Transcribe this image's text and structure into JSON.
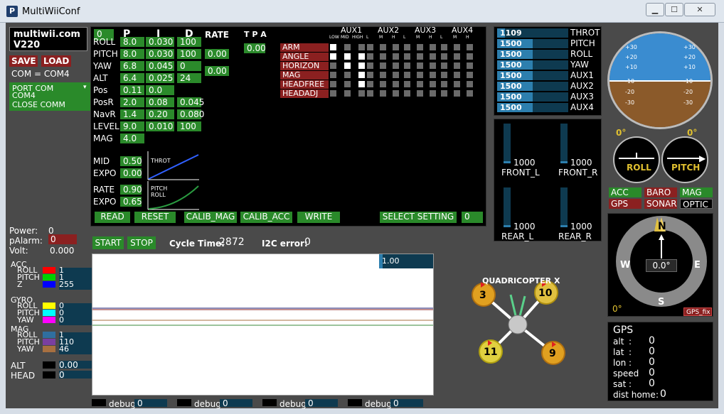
{
  "window": {
    "title": "MultiWiiConf"
  },
  "brand": {
    "name": "multiwii.com",
    "version": "V220"
  },
  "com": {
    "save": "SAVE",
    "load": "LOAD",
    "com_label": "COM = COM4",
    "port_com": "PORT COM",
    "port_value": "COM4",
    "close_comm": "CLOSE COMM"
  },
  "pid": {
    "setting_index": "0",
    "headers": {
      "p": "P",
      "i": "I",
      "d": "D",
      "rate": "RATE",
      "tpa": "T P A"
    },
    "tpa_value": "0.00",
    "rows": [
      {
        "name": "ROLL",
        "p": "8.0",
        "i": "0.030",
        "d": "100"
      },
      {
        "name": "PITCH",
        "p": "8.0",
        "i": "0.030",
        "d": "100"
      },
      {
        "name": "YAW",
        "p": "6.8",
        "i": "0.045",
        "d": "0"
      },
      {
        "name": "ALT",
        "p": "6.4",
        "i": "0.025",
        "d": "24"
      },
      {
        "name": "Pos",
        "p": "0.11",
        "i": "0.0",
        "d": ""
      },
      {
        "name": "PosR",
        "p": "2.0",
        "i": "0.08",
        "d": "0.045"
      },
      {
        "name": "NavR",
        "p": "1.4",
        "i": "0.20",
        "d": "0.080"
      },
      {
        "name": "LEVEL",
        "p": "9.0",
        "i": "0.010",
        "d": "100"
      },
      {
        "name": "MAG",
        "p": "4.0",
        "i": "",
        "d": ""
      }
    ],
    "rate_rollpitch": "0.00",
    "rate_yaw": "0.00",
    "throttle": {
      "mid_label": "MID",
      "mid": "0.50",
      "expo_label": "EXPO",
      "expo": "0.00",
      "curve_label": "THROT"
    },
    "rc": {
      "rate_label": "RATE",
      "rate": "0.90",
      "expo_label": "EXPO",
      "expo": "0.65",
      "curve_label_1": "PITCH",
      "curve_label_2": "ROLL"
    }
  },
  "buttons": {
    "read": "READ",
    "reset": "RESET",
    "calib_mag": "CALIB_MAG",
    "calib_acc": "CALIB_ACC",
    "write": "WRITE",
    "select_setting": "SELECT SETTING",
    "select_value": "0"
  },
  "aux": {
    "headers": [
      "AUX1",
      "AUX2",
      "AUX3",
      "AUX4"
    ],
    "sub_first": [
      "LOW",
      "MID",
      "HIGH"
    ],
    "sub": [
      "L",
      "M",
      "H"
    ],
    "boxes": [
      {
        "name": "ARM",
        "checks": [
          1,
          0,
          0,
          0,
          0,
          0,
          0,
          0,
          0,
          0,
          0,
          0
        ]
      },
      {
        "name": "ANGLE",
        "checks": [
          1,
          1,
          1,
          0,
          0,
          0,
          0,
          0,
          0,
          0,
          0,
          0
        ]
      },
      {
        "name": "HORIZON",
        "checks": [
          0,
          1,
          1,
          0,
          0,
          0,
          0,
          0,
          0,
          0,
          0,
          0
        ]
      },
      {
        "name": "MAG",
        "checks": [
          0,
          0,
          1,
          0,
          0,
          0,
          0,
          0,
          0,
          0,
          0,
          0
        ]
      },
      {
        "name": "HEADFREE",
        "checks": [
          0,
          0,
          1,
          0,
          0,
          0,
          0,
          0,
          0,
          0,
          0,
          0
        ]
      },
      {
        "name": "HEADADJ",
        "checks": [
          0,
          0,
          0,
          0,
          0,
          0,
          0,
          0,
          0,
          0,
          0,
          0
        ]
      }
    ]
  },
  "rc_channels": [
    {
      "name": "THROT",
      "value": "1109",
      "fraction": 0.11
    },
    {
      "name": "PITCH",
      "value": "1500",
      "fraction": 0.5
    },
    {
      "name": "ROLL",
      "value": "1500",
      "fraction": 0.5
    },
    {
      "name": "YAW",
      "value": "1500",
      "fraction": 0.5
    },
    {
      "name": "AUX1",
      "value": "1500",
      "fraction": 0.5
    },
    {
      "name": "AUX2",
      "value": "1500",
      "fraction": 0.5
    },
    {
      "name": "AUX3",
      "value": "1500",
      "fraction": 0.5
    },
    {
      "name": "AUX4",
      "value": "1500",
      "fraction": 0.5
    }
  ],
  "motors": [
    {
      "name": "FRONT_L",
      "value": "1000",
      "fraction": 0.05
    },
    {
      "name": "FRONT_R",
      "value": "1000",
      "fraction": 0.05
    },
    {
      "name": "REAR_L",
      "value": "1000",
      "fraction": 0.05
    },
    {
      "name": "REAR_R",
      "value": "1000",
      "fraction": 0.05
    }
  ],
  "status": {
    "power_label": "Power:",
    "power": "0",
    "palarm_label": "pAlarm:",
    "palarm": "0",
    "volt_label": "Volt:",
    "volt": "0.000",
    "start": "START",
    "stop": "STOP",
    "cycle_label": "Cycle Time:",
    "cycle": "2872",
    "i2c_label": "I2C error:",
    "i2c": "0"
  },
  "sensors": {
    "acc": {
      "label": "ACC",
      "roll": "1",
      "pitch": "1",
      "z": "255"
    },
    "gyro": {
      "label": "GYRO",
      "roll": "0",
      "pitch": "0",
      "yaw": "0"
    },
    "mag": {
      "label": "MAG",
      "roll": "1",
      "pitch": "110",
      "yaw": "46"
    },
    "alt": {
      "label": "ALT",
      "value": "0.00"
    },
    "head": {
      "label": "HEAD",
      "value": "0"
    },
    "axis_labels": {
      "roll": "ROLL",
      "pitch": "PITCH",
      "yaw": "YAW",
      "z": "Z"
    },
    "colors": {
      "roll": "#ff0000",
      "pitch": "#00d000",
      "yaw": "#ff00ff",
      "z": "#0000ff",
      "gyro_roll": "#ffff00",
      "gyro_pitch": "#00ffff",
      "mag_roll": "#2f6fa0",
      "mag_pitch": "#7a3fa0",
      "mag_yaw": "#a87040"
    }
  },
  "graph": {
    "scale": "1.00"
  },
  "debug": [
    {
      "label": "debug",
      "value": "0"
    },
    {
      "label": "debug",
      "value": "0"
    },
    {
      "label": "debug",
      "value": "0"
    },
    {
      "label": "debug",
      "value": "0"
    }
  ],
  "quad": {
    "title": "QUADRICOPTER X",
    "motors": [
      "3",
      "10",
      "11",
      "9"
    ]
  },
  "horizon": {
    "ticks_left": [
      "+30",
      "+20",
      "+10",
      "-10",
      "-20",
      "-30"
    ],
    "ticks_right": [
      "+30",
      "+20",
      "+10",
      "-10",
      "-20",
      "-30"
    ],
    "roll_angle": "0°",
    "pitch_angle": "0°",
    "roll_label": "ROLL",
    "pitch_label": "PITCH"
  },
  "sensor_flags": [
    {
      "name": "ACC",
      "color": "#2a8a2a"
    },
    {
      "name": "BARO",
      "color": "#8b2020"
    },
    {
      "name": "MAG",
      "color": "#2a8a2a"
    },
    {
      "name": "GPS",
      "color": "#8b2020"
    },
    {
      "name": "SONAR",
      "color": "#8b2020"
    },
    {
      "name": "OPTIC",
      "color": "#000000"
    }
  ],
  "compass": {
    "heading": "0.0°",
    "n": "N",
    "s": "S",
    "e": "E",
    "w": "W",
    "zero": "0°",
    "gps_fix": "GPS_fix"
  },
  "gps": {
    "title": "GPS",
    "rows": [
      {
        "label": "alt",
        "value": "0"
      },
      {
        "label": "lat",
        "value": "0"
      },
      {
        "label": "lon",
        "value": "0"
      },
      {
        "label": "speed",
        "value": "0"
      },
      {
        "label": "sat",
        "value": "0"
      },
      {
        "label": "dist home",
        "value": "0"
      }
    ]
  }
}
